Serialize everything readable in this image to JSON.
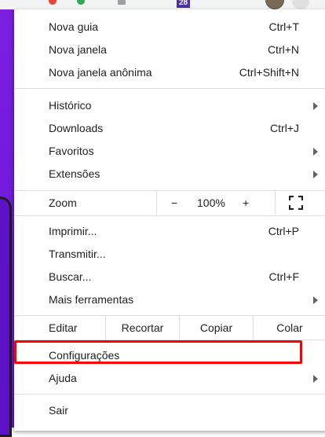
{
  "topbar": {
    "badge": "28"
  },
  "menu": {
    "group1": [
      {
        "label": "Nova guia",
        "shortcut": "Ctrl+T"
      },
      {
        "label": "Nova janela",
        "shortcut": "Ctrl+N"
      },
      {
        "label": "Nova janela anônima",
        "shortcut": "Ctrl+Shift+N"
      }
    ],
    "group2": [
      {
        "label": "Histórico",
        "submenu": true
      },
      {
        "label": "Downloads",
        "shortcut": "Ctrl+J"
      },
      {
        "label": "Favoritos",
        "submenu": true
      },
      {
        "label": "Extensões",
        "submenu": true
      }
    ],
    "zoom": {
      "label": "Zoom",
      "minus": "−",
      "value": "100%",
      "plus": "+"
    },
    "group3": [
      {
        "label": "Imprimir...",
        "shortcut": "Ctrl+P"
      },
      {
        "label": "Transmitir..."
      },
      {
        "label": "Buscar...",
        "shortcut": "Ctrl+F"
      },
      {
        "label": "Mais ferramentas",
        "submenu": true
      }
    ],
    "edit": {
      "label": "Editar",
      "cut": "Recortar",
      "copy": "Copiar",
      "paste": "Colar"
    },
    "group4": [
      {
        "label": "Configurações"
      },
      {
        "label": "Ajuda",
        "submenu": true
      }
    ],
    "exit": {
      "label": "Sair"
    }
  },
  "colors": {
    "highlight": "#ff0000",
    "background_accent": "#7b1fe0"
  }
}
